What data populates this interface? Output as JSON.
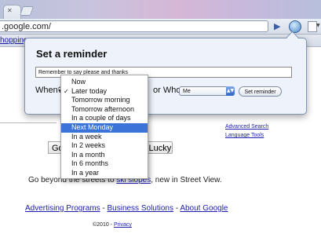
{
  "browser": {
    "omnibox_text": ".google.com/",
    "bookmark_item": "hopping"
  },
  "page": {
    "advanced_search": "Advanced Search",
    "language_tools": "Language Tools",
    "search_button": "Go",
    "lucky_button": "'m Feeling Lucky",
    "promo_before": "Go beyond the streets to ",
    "promo_link": "ski slopes",
    "promo_after": ", new in Street View.",
    "footer": {
      "advertising": "Advertising Programs",
      "sep1": " - ",
      "business": "Business Solutions",
      "sep2": " - ",
      "about": "About Google"
    },
    "copyright": "©2010 - ",
    "privacy": "Privacy"
  },
  "popup": {
    "title": "Set a reminder",
    "reminder_text": "Remember to say please and thanks",
    "when_label": "When?",
    "for_who_label": "or Who?",
    "who_value": "Me",
    "set_button": "Set reminder"
  },
  "when_menu": {
    "selected_index": 1,
    "highlighted_index": 5,
    "checkmark": "✓",
    "items": [
      "Now",
      "Later today",
      "Tomorrow morning",
      "Tomorrow afternoon",
      "In a couple of days",
      "Next Monday",
      "In a week",
      "In 2 weeks",
      "In a month",
      "In 6 months",
      "In a year"
    ]
  },
  "colors": {
    "highlight": "#3b73d9",
    "link": "#2020b0",
    "popup_bg": "#eef3fb"
  }
}
